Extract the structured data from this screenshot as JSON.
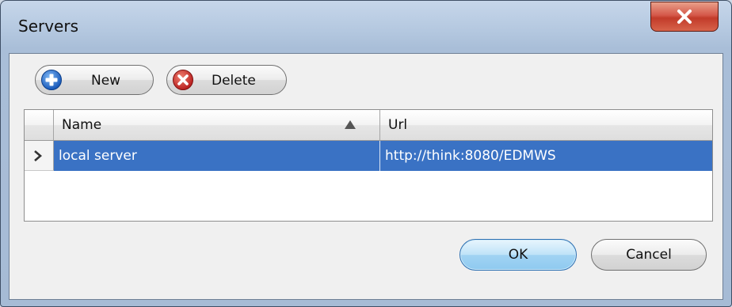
{
  "window": {
    "title": "Servers"
  },
  "toolbar": {
    "new_label": "New",
    "delete_label": "Delete"
  },
  "grid": {
    "columns": [
      {
        "label": "Name",
        "sort": "ascending"
      },
      {
        "label": "Url"
      }
    ],
    "rows": [
      {
        "name": "local server",
        "url": "http://think:8080/EDMWS",
        "selected": true
      }
    ]
  },
  "buttons": {
    "ok_label": "OK",
    "cancel_label": "Cancel"
  },
  "icons": {
    "close": "close-icon",
    "new": "plus-circle-icon",
    "delete": "x-circle-icon",
    "sort": "sort-ascending-icon",
    "row_pointer": "row-pointer-icon"
  },
  "colors": {
    "selection": "#3a72c4",
    "close_button": "#c23b2a",
    "default_button": "#8fcaf0"
  }
}
